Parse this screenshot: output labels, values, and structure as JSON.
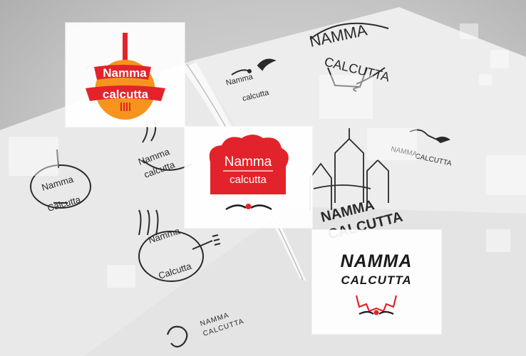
{
  "scene": {
    "description_alt": "Notebook with sketched logo concepts",
    "paper_color": "#ececec",
    "ink_color": "#2a2a2a"
  },
  "logos": {
    "round": {
      "line1": "Namma",
      "line2": "calcutta",
      "fill": "#f7941d",
      "banner": "#e3232b"
    },
    "chef": {
      "line1": "Namma",
      "line2": "calcutta",
      "color": "#e3232b"
    },
    "handlettered": {
      "line1": "NAMMA",
      "line2": "CALCUTTA",
      "accent": "#e3232b"
    }
  },
  "sketches": {
    "top_left_1": "Namma",
    "top_left_2": "calcutta",
    "top_right_1": "NAMMA",
    "top_right_2": "CALCUTTA",
    "mid_left_1": "Namma",
    "mid_left_2": "Calcutta",
    "right_mid_1": "NAMMA",
    "right_mid_2": "CALCUTTA",
    "bottom_left_1": "Namma",
    "bottom_left_2": "Calcutta",
    "bottom_1": "NAMMA",
    "bottom_2": "CALCUTTA"
  }
}
